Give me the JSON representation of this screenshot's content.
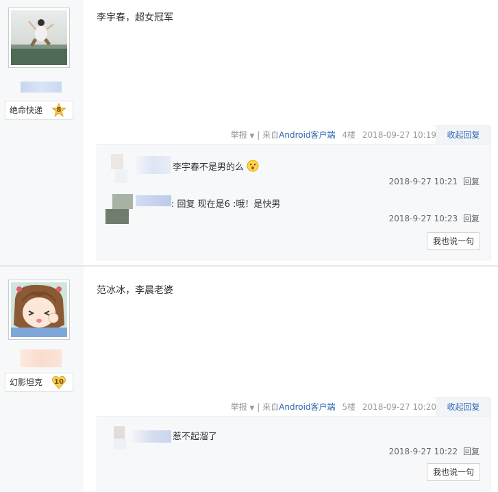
{
  "colors": {
    "link": "#2d64b3",
    "sidebar_bg": "#f7f8fa",
    "reply_bg": "#f7f8fa",
    "meta_text": "#999999"
  },
  "posts": [
    {
      "badge_name": "绝命快递",
      "badge_level": "8",
      "content": "李宇春，超女冠军",
      "meta": {
        "report": "举报",
        "sep": "| 来自",
        "client": "Android客户端",
        "floor": "4楼",
        "time": "2018-09-27 10:19"
      },
      "collapse_label": "收起回复",
      "replies": [
        {
          "text": "李宇春不是男的么",
          "emoji": "face-emoji",
          "time": "2018-9-27 10:21",
          "reply_label": "回复"
        },
        {
          "text": ": 回复 现在是6 :哦！是快男",
          "time": "2018-9-27 10:23",
          "reply_label": "回复"
        }
      ],
      "say_button": "我也说一句"
    },
    {
      "badge_name": "幻影坦克",
      "badge_level": "10",
      "content": "范冰冰，李晨老婆",
      "meta": {
        "report": "举报",
        "sep": "| 来自",
        "client": "Android客户端",
        "floor": "5楼",
        "time": "2018-09-27 10:20"
      },
      "collapse_label": "收起回复",
      "replies": [
        {
          "text": "惹不起溜了",
          "time": "2018-9-27 10:22",
          "reply_label": "回复"
        }
      ],
      "say_button": "我也说一句"
    }
  ]
}
